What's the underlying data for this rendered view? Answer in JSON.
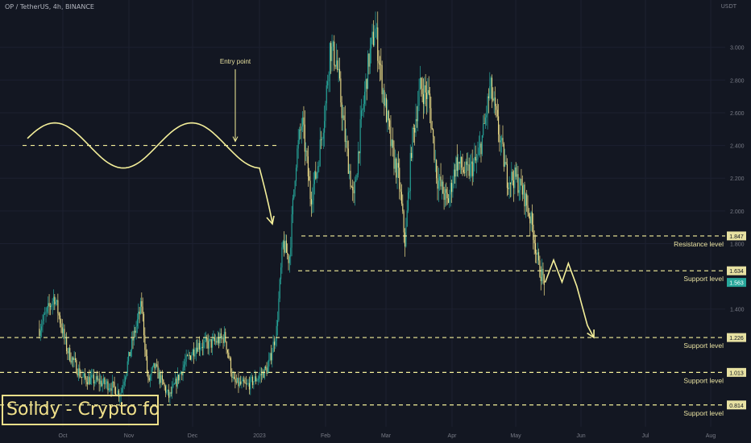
{
  "header": {
    "ticker": "OP / TetherUS, 4h, BINANCE",
    "unit": "USDT"
  },
  "watermark": "Solldy - Crypto for U",
  "chart_data": {
    "type": "candlestick",
    "symbol": "OP / TetherUS",
    "interval": "4h",
    "exchange": "BINANCE",
    "x_ticks": [
      "Oct",
      "Nov",
      "Dec",
      "2023",
      "Feb",
      "Mar",
      "Apr",
      "May",
      "Jun",
      "Jul",
      "Aug"
    ],
    "y_ticks": [
      "3.000",
      "2.800",
      "2.600",
      "2.400",
      "2.200",
      "2.000",
      "1.800",
      "1.400"
    ],
    "ylim": [
      0.68,
      3.22
    ],
    "price_path": [
      [
        "Sep 20",
        1.28
      ],
      [
        "Sep 27",
        1.48
      ],
      [
        "Oct 3",
        1.15
      ],
      [
        "Oct 10",
        0.98
      ],
      [
        "Oct 17",
        0.96
      ],
      [
        "Oct 24",
        0.93
      ],
      [
        "Oct 28",
        0.88
      ],
      [
        "Nov 3",
        1.22
      ],
      [
        "Nov 7",
        1.43
      ],
      [
        "Nov 10",
        0.95
      ],
      [
        "Nov 13",
        1.05
      ],
      [
        "Nov 20",
        0.86
      ],
      [
        "Nov 27",
        1.06
      ],
      [
        "Dec 3",
        1.18
      ],
      [
        "Dec 10",
        1.19
      ],
      [
        "Dec 16",
        1.23
      ],
      [
        "Dec 20",
        0.95
      ],
      [
        "Dec 26",
        0.93
      ],
      [
        "Jan 1",
        0.99
      ],
      [
        "Jan 5",
        1.04
      ],
      [
        "Jan 9",
        1.27
      ],
      [
        "Jan 12",
        1.8
      ],
      [
        "Jan 15",
        1.7
      ],
      [
        "Jan 18",
        2.3
      ],
      [
        "Jan 21",
        2.55
      ],
      [
        "Jan 25",
        2.08
      ],
      [
        "Jan 28",
        2.25
      ],
      [
        "Feb 1",
        2.65
      ],
      [
        "Feb 3",
        3.0
      ],
      [
        "Feb 6",
        2.92
      ],
      [
        "Feb 10",
        2.45
      ],
      [
        "Feb 14",
        2.05
      ],
      [
        "Feb 17",
        2.48
      ],
      [
        "Feb 21",
        2.92
      ],
      [
        "Feb 24",
        3.12
      ],
      [
        "Feb 28",
        2.7
      ],
      [
        "Mar 4",
        2.35
      ],
      [
        "Mar 7",
        2.2
      ],
      [
        "Mar 10",
        1.8
      ],
      [
        "Mar 13",
        2.4
      ],
      [
        "Mar 17",
        2.75
      ],
      [
        "Mar 21",
        2.7
      ],
      [
        "Mar 25",
        2.2
      ],
      [
        "Mar 30",
        2.05
      ],
      [
        "Apr 3",
        2.3
      ],
      [
        "Apr 8",
        2.23
      ],
      [
        "Apr 13",
        2.31
      ],
      [
        "Apr 16",
        2.5
      ],
      [
        "Apr 19",
        2.76
      ],
      [
        "Apr 23",
        2.48
      ],
      [
        "Apr 27",
        2.2
      ],
      [
        "May 1",
        2.2
      ],
      [
        "May 5",
        2.1
      ],
      [
        "May 9",
        1.9
      ],
      [
        "May 12",
        1.65
      ],
      [
        "May 15",
        1.563
      ]
    ],
    "current_price": 1.563,
    "levels": [
      {
        "value": 1.847,
        "tag": "1.847",
        "label": "Resistance level"
      },
      {
        "value": 1.634,
        "tag": "1.634",
        "label": "Support level"
      },
      {
        "value": 1.226,
        "tag": "1.226",
        "label": "Support level"
      },
      {
        "value": 1.013,
        "tag": "1.013",
        "label": "Support level"
      },
      {
        "value": 0.814,
        "tag": "0.814",
        "label": "Support level"
      }
    ],
    "current_tag": "1.563",
    "entry_level": 2.4,
    "annotation": "Entry point",
    "projection": [
      [
        "May 15",
        1.563
      ],
      [
        "May 19",
        1.7
      ],
      [
        "May 23",
        1.565
      ],
      [
        "May 26",
        1.68
      ],
      [
        "May 30",
        1.54
      ],
      [
        "Jun 4",
        1.3
      ],
      [
        "Jun 7",
        1.226
      ]
    ],
    "grid": "on"
  },
  "colors": {
    "background": "#131722",
    "up": "#26a69a",
    "down": "#f0e08a",
    "line": "#f4ef9a",
    "label": "#e8e1a0",
    "tag": "#e7e1a2",
    "current_tag": "#26a69a",
    "axis_text": "#787b86"
  }
}
